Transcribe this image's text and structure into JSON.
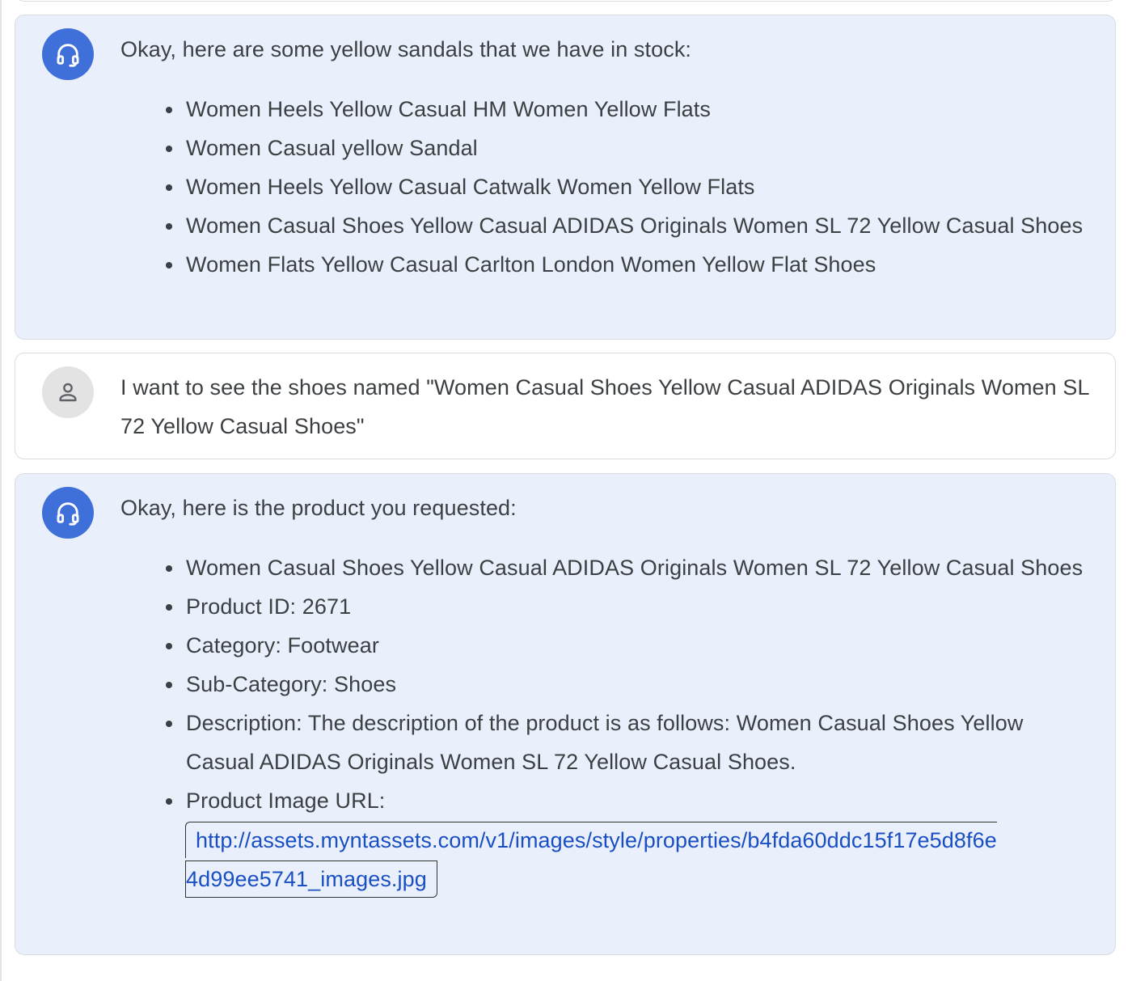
{
  "conversation": {
    "message1": {
      "role": "assistant",
      "avatar_icon": "headset-icon",
      "intro": "Okay, here are some yellow sandals that we have in stock:",
      "items": [
        "Women Heels Yellow Casual HM Women Yellow Flats",
        "Women Casual yellow Sandal",
        "Women Heels Yellow Casual Catwalk Women Yellow Flats",
        "Women Casual Shoes Yellow Casual ADIDAS Originals Women SL 72 Yellow Casual Shoes",
        "Women Flats Yellow Casual Carlton London Women Yellow Flat Shoes"
      ]
    },
    "message2": {
      "role": "user",
      "avatar_icon": "person-icon",
      "text": "I want to see the shoes named \"Women Casual Shoes Yellow Casual ADIDAS Originals Women SL 72 Yellow Casual Shoes\""
    },
    "message3": {
      "role": "assistant",
      "avatar_icon": "headset-icon",
      "intro": "Okay, here is the product you requested:",
      "items": [
        "Women Casual Shoes Yellow Casual ADIDAS Originals Women SL 72 Yellow Casual Shoes",
        "Product ID: 2671",
        "Category: Footwear",
        "Sub-Category: Shoes",
        "Description: The description of the product is as follows: Women Casual Shoes Yellow Casual ADIDAS Originals Women SL 72 Yellow Casual Shoes."
      ],
      "image_url_label": "Product Image URL:",
      "image_url_part1": "http://assets.myntassets.com/v1/images/style/properties/b4fda60ddc15f17e5d8f6e",
      "image_url_part2": "4d99ee5741_images.jpg"
    }
  },
  "colors": {
    "assistant_bubble": "#e9f0fc",
    "assistant_avatar": "#3f6fd8",
    "user_avatar": "#e3e3e3",
    "link": "#1a4fc4",
    "text": "#3c4043"
  }
}
